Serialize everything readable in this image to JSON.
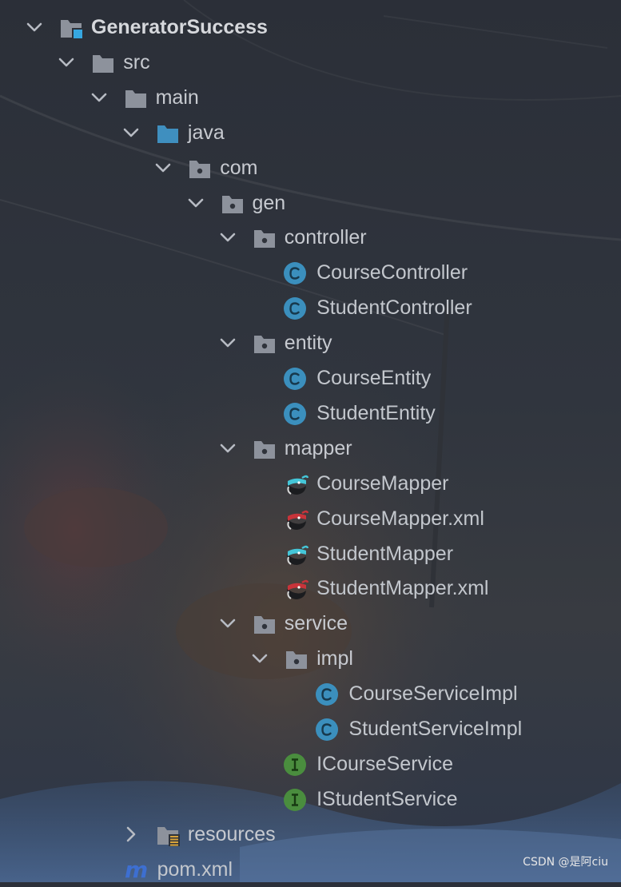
{
  "project_tree": {
    "nodes": [
      {
        "id": "n0",
        "label": "GeneratorSuccess",
        "type": "module",
        "depth": 0,
        "expanded": true,
        "bold": true
      },
      {
        "id": "n1",
        "label": "src",
        "type": "folder",
        "depth": 1,
        "expanded": true
      },
      {
        "id": "n2",
        "label": "main",
        "type": "folder",
        "depth": 2,
        "expanded": true
      },
      {
        "id": "n3",
        "label": "java",
        "type": "source-folder",
        "depth": 3,
        "expanded": true
      },
      {
        "id": "n4",
        "label": "com",
        "type": "package",
        "depth": 4,
        "expanded": true
      },
      {
        "id": "n5",
        "label": "gen",
        "type": "package",
        "depth": 5,
        "expanded": true
      },
      {
        "id": "n6",
        "label": "controller",
        "type": "package",
        "depth": 6,
        "expanded": true
      },
      {
        "id": "n7",
        "label": "CourseController",
        "type": "class",
        "depth": 7
      },
      {
        "id": "n8",
        "label": "StudentController",
        "type": "class",
        "depth": 7
      },
      {
        "id": "n9",
        "label": "entity",
        "type": "package",
        "depth": 6,
        "expanded": true
      },
      {
        "id": "n10",
        "label": "CourseEntity",
        "type": "class",
        "depth": 7
      },
      {
        "id": "n11",
        "label": "StudentEntity",
        "type": "class",
        "depth": 7
      },
      {
        "id": "n12",
        "label": "mapper",
        "type": "package",
        "depth": 6,
        "expanded": true
      },
      {
        "id": "n13",
        "label": "CourseMapper",
        "type": "mapper-interface",
        "depth": 7
      },
      {
        "id": "n14",
        "label": "CourseMapper.xml",
        "type": "mapper-xml",
        "depth": 7
      },
      {
        "id": "n15",
        "label": "StudentMapper",
        "type": "mapper-interface",
        "depth": 7
      },
      {
        "id": "n16",
        "label": "StudentMapper.xml",
        "type": "mapper-xml",
        "depth": 7
      },
      {
        "id": "n17",
        "label": "service",
        "type": "package",
        "depth": 6,
        "expanded": true
      },
      {
        "id": "n18",
        "label": "impl",
        "type": "package",
        "depth": 7,
        "expanded": true
      },
      {
        "id": "n19",
        "label": "CourseServiceImpl",
        "type": "class",
        "depth": 8
      },
      {
        "id": "n20",
        "label": "StudentServiceImpl",
        "type": "class",
        "depth": 8
      },
      {
        "id": "n21",
        "label": "ICourseService",
        "type": "interface",
        "depth": 7
      },
      {
        "id": "n22",
        "label": "IStudentService",
        "type": "interface",
        "depth": 7
      },
      {
        "id": "n23",
        "label": "resources",
        "type": "resources-folder",
        "depth": 3,
        "expanded": false
      },
      {
        "id": "n24",
        "label": "pom.xml",
        "type": "maven-file",
        "depth": 2
      }
    ]
  },
  "watermark": {
    "text": "CSDN @是阿ciu"
  },
  "colors": {
    "background": "#2c3039",
    "folder": "#8d929c",
    "source_folder": "#3f8fbf",
    "class_icon": "#3b8fbd",
    "interface_icon": "#4a8d3e",
    "text": "#c7cad0",
    "chevron": "#b7bbc3",
    "maven": "#3d6fd1"
  },
  "icons": {
    "module": "module-folder-icon",
    "folder": "folder-icon",
    "source-folder": "source-folder-icon",
    "package": "package-icon",
    "class": "class-icon",
    "interface": "interface-icon",
    "mapper-interface": "mybatis-mapper-icon",
    "mapper-xml": "mybatis-xml-icon",
    "resources-folder": "resources-folder-icon",
    "maven-file": "maven-pom-icon",
    "expanded": "chevron-down-icon",
    "collapsed": "chevron-right-icon"
  }
}
